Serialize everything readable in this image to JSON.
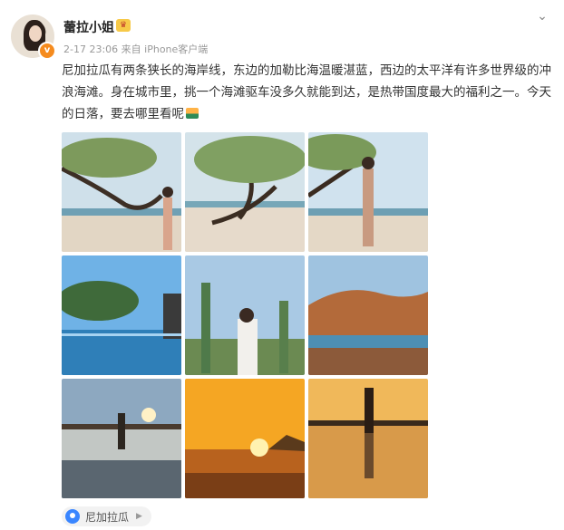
{
  "post": {
    "username": "蕾拉小姐",
    "verified_badge": "v",
    "meta": "2-17 23:06 来自 iPhone客户端",
    "menu_icon": "chevron-down-icon",
    "text": "尼加拉瓜有两条狭长的海岸线，东边的加勒比海温暖湛蓝，西边的太平洋有许多世界级的冲浪海滩。身在城市里，挑一个海滩驱车没多久就能到达，是热带国度最大的福利之一。今天的日落，要去哪里看呢",
    "photos": [
      {
        "scene": "tree-beach-woman"
      },
      {
        "scene": "tree-beach"
      },
      {
        "scene": "tree-beach-woman-2"
      },
      {
        "scene": "infinity-pool"
      },
      {
        "scene": "cactus-woman"
      },
      {
        "scene": "rocky-coast"
      },
      {
        "scene": "sunset-woman-beach"
      },
      {
        "scene": "sunset-sea"
      },
      {
        "scene": "sunset-reflection-woman"
      }
    ],
    "location": "尼加拉瓜"
  },
  "colors": {
    "accent": "#3a86ff",
    "badge": "#f58b1e",
    "text": "#333333",
    "meta": "#999999"
  }
}
